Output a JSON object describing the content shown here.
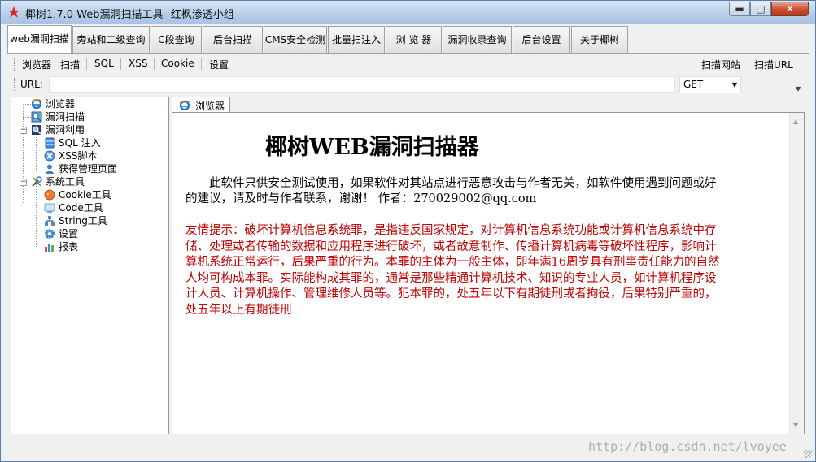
{
  "window": {
    "title": "椰树1.7.0  Web漏洞扫描工具--红枫渗透小组",
    "minimize_glyph": "▬",
    "maximize_glyph": "□",
    "close_glyph": "✕"
  },
  "main_tabs": [
    {
      "label": "web漏洞扫描",
      "active": true
    },
    {
      "label": "旁站和二级查询"
    },
    {
      "label": "C段查询"
    },
    {
      "label": "后台扫描"
    },
    {
      "label": "CMS安全检测"
    },
    {
      "label": "批量扫注入"
    },
    {
      "label": "浏 览 器"
    },
    {
      "label": "漏洞收录查询"
    },
    {
      "label": "后台设置"
    },
    {
      "label": "关于椰树"
    }
  ],
  "toolbar": {
    "items": [
      "浏览器",
      "扫描",
      "SQL",
      "XSS",
      "Cookie",
      "设置"
    ],
    "right_items": [
      "扫描网站",
      "扫描URL"
    ]
  },
  "urlbar": {
    "label": "URL:",
    "value": "",
    "method": "GET"
  },
  "tree": {
    "browser": "浏览器",
    "vuln_scan": "漏洞扫描",
    "vuln_exploit": "漏洞利用",
    "sql_inject": "SQL 注入",
    "xss_script": "XSS脚本",
    "get_admin": "获得管理页面",
    "system_tools": "系统工具",
    "cookie_tool": "Cookie工具",
    "code_tool": "Code工具",
    "string_tool": "String工具",
    "settings": "设置",
    "report": "报表"
  },
  "browser": {
    "tab_label": "浏览器",
    "heading": "椰树WEB漏洞扫描器",
    "intro": "此软件只供安全测试使用，如果软件对其站点进行恶意攻击与作者无关，如软件使用遇到问题或好的建议，请及时与作者联系，谢谢！  作者：270029002@qq.com",
    "warning": "友情提示：破坏计算机信息系统罪，是指违反国家规定，对计算机信息系统功能或计算机信息系统中存储、处理或者传输的数据和应用程序进行破坏，或者故意制作、传播计算机病毒等破坏性程序，影响计算机系统正常运行，后果严重的行为。本罪的主体为一般主体，即年满16周岁具有刑事责任能力的自然人均可构成本罪。实际能构成其罪的，通常是那些精通计算机技术、知识的专业人员，如计算机程序设计人员、计算机操作、管理维修人员等。犯本罪的，处五年以下有期徒刑或者拘役，后果特别严重的，处五年以上有期徒刑"
  },
  "watermark": "http://blog.csdn.net/lvoyee",
  "colors": {
    "warning_text": "#c00000",
    "titlebar": "#bcd2ea"
  }
}
